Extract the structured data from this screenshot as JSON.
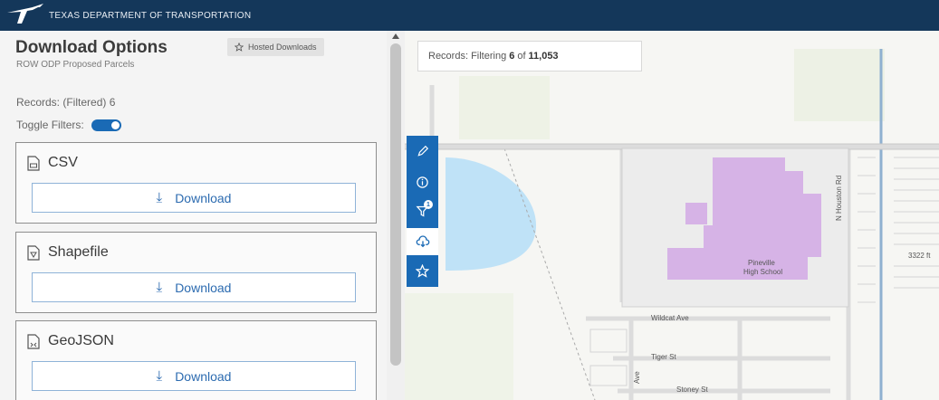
{
  "header": {
    "agency": "TEXAS DEPARTMENT OF TRANSPORTATION"
  },
  "panel": {
    "title": "Download Options",
    "hosted_label": "Hosted Downloads",
    "subtitle": "ROW ODP Proposed Parcels",
    "records_label": "Records: (Filtered) 6",
    "toggle_label": "Toggle Filters:",
    "toggle_on": true,
    "formats": [
      {
        "name": "CSV",
        "button": "Download"
      },
      {
        "name": "Shapefile",
        "button": "Download"
      },
      {
        "name": "GeoJSON",
        "button": "Download"
      }
    ]
  },
  "map": {
    "records_prefix": "Records: Filtering",
    "records_filtered": "6",
    "records_of": "of",
    "records_total": "11,053",
    "labels": {
      "school_line1": "Pineville",
      "school_line2": "High School",
      "wildcat": "Wildcat Ave",
      "tiger": "Tiger St",
      "street3": "Stoney St",
      "vertical_road": "N Houston Rd",
      "right_edge": "3322 ft",
      "vertical_ave": "Ave"
    }
  },
  "toolbar": {
    "filter_badge": "1"
  },
  "colors": {
    "header": "#14375a",
    "accent": "#1a6ab5",
    "school": "#d6b3e6",
    "water": "#bfe2f7"
  }
}
